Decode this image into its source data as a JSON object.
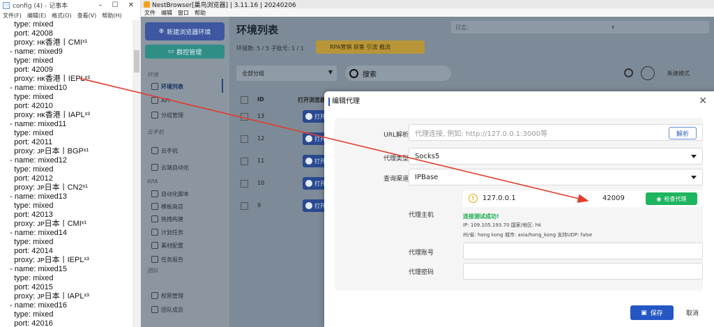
{
  "notepad": {
    "title": "config (4) - 记事本",
    "window_controls": [
      "–",
      "☐",
      "✕"
    ],
    "menu": [
      "文件(F)",
      "编辑(E)",
      "格式(O)",
      "查看(V)",
      "帮助(H)"
    ],
    "lines": [
      "    type: mixed",
      "    port: 42008",
      "    proxy: ʜᴋ香港丨CMIˣ¹",
      "  - name: mixed9",
      "    type: mixed",
      "    port: 42009",
      "    proxy: ʜᴋ香港丨IEPLˣ³",
      "  - name: mixed10",
      "    type: mixed",
      "    port: 42010",
      "    proxy: ʜᴋ香港丨IAPLˣ³",
      "  - name: mixed11",
      "    type: mixed",
      "    port: 42011",
      "    proxy: ᴊᴘ日本丨BGPˣ¹",
      "  - name: mixed12",
      "    type: mixed",
      "    port: 42012",
      "    proxy: ᴊᴘ日本丨CN2ˣ¹",
      "  - name: mixed13",
      "    type: mixed",
      "    port: 42013",
      "    proxy: ᴊᴘ日本丨CMIˣ¹",
      "  - name: mixed14",
      "    type: mixed",
      "    port: 42014",
      "    proxy: ᴊᴘ日本丨IEPLˣ³",
      "  - name: mixed15",
      "    type: mixed",
      "    port: 42015",
      "    proxy: ᴊᴘ日本丨IAPLˣ³",
      "  - name: mixed16",
      "    type: mixed",
      "    port: 42016"
    ]
  },
  "browser": {
    "title": "NestBrowser[巢鸟浏览器] | 3.11.16 | 20240206",
    "menu": [
      "文件",
      "编辑",
      "窗口",
      "帮助"
    ],
    "new_env_button": "新建浏览器环境",
    "group_manage_button": "群控管理",
    "sidebar": [
      {
        "section": "环境"
      },
      {
        "label": "环境列表",
        "active": true
      },
      {
        "label": "API"
      },
      {
        "label": "分组管理"
      },
      {
        "section": "云手机"
      },
      {
        "label": "云手机"
      },
      {
        "label": "云端自动化"
      },
      {
        "section": "RPA"
      },
      {
        "label": "自动化脚本"
      },
      {
        "label": "模板商店"
      },
      {
        "label": "拖拽构建"
      },
      {
        "label": "计划任务"
      },
      {
        "label": "素材配置"
      },
      {
        "label": "任务报告"
      },
      {
        "section": "团队"
      },
      {
        "label": "权限管理"
      },
      {
        "label": "团队成员"
      }
    ],
    "main_title": "环境列表",
    "stats": "环境数: 5 / 5    子账号: 1 / 1",
    "rpa_chip": "RPA营销 获客 引流 截流",
    "date_label": "日志:",
    "group_select": "全部分组",
    "search_label": "搜索",
    "new_mode_label": "新建模式",
    "table_headers": [
      "ID",
      "打开浏览器"
    ],
    "rows": [
      {
        "id": "13",
        "open": "打开"
      },
      {
        "id": "12",
        "open": "打开"
      },
      {
        "id": "11",
        "open": "打开"
      },
      {
        "id": "10",
        "open": "打开"
      },
      {
        "id": "9",
        "open": "打开"
      }
    ]
  },
  "modal": {
    "title": "编辑代理",
    "url_label": "URL解析",
    "url_placeholder": "代理连接, 例如: http://127.0.0.1:3000等",
    "parse_button": "解析",
    "proxy_type_label": "代理类型",
    "proxy_type_value": "Socks5",
    "query_channel_label": "查询渠道",
    "query_channel_value": "IPBase",
    "host_label": "代理主机",
    "host_value": "127.0.0.1",
    "port_value": "42009",
    "check_button": "检查代理",
    "test_success": "连接测试成功!",
    "ip_info": "IP: 109.105.193.70 国家/地区: hk",
    "region_info": "州/省: hong kong 城市: asia/hong_kong 支持UDP: false",
    "account_label": "代理账号",
    "password_label": "代理密码",
    "save_button": "保存",
    "cancel_button": "取消"
  },
  "colors": {
    "arrow": "#e23c2c",
    "primary": "#2457c4",
    "success": "#1eb55f"
  }
}
